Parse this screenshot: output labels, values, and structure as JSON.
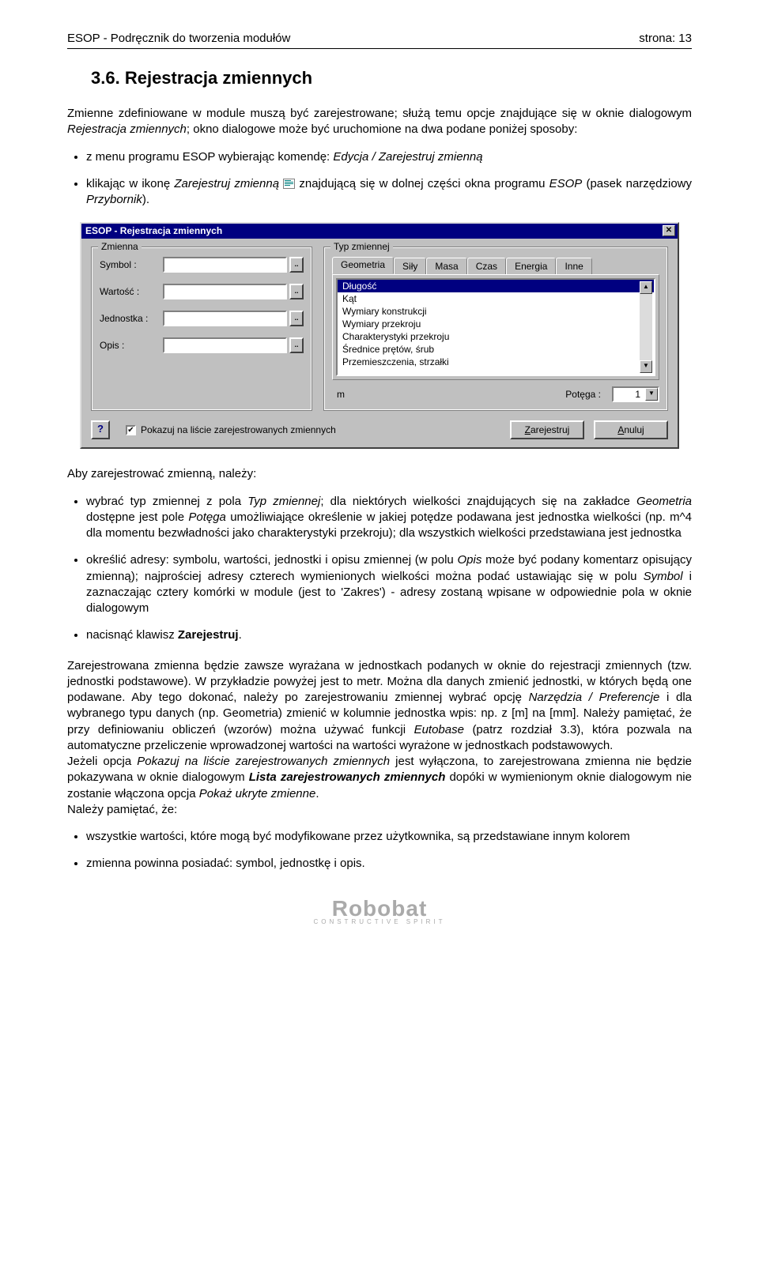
{
  "header": {
    "left": "ESOP - Podręcznik do tworzenia modułów",
    "right": "strona: 13"
  },
  "section": {
    "number": "3.6.",
    "title": "Rejestracja zmiennych"
  },
  "intro": {
    "p1_a": "Zmienne zdefiniowane w module muszą być zarejestrowane; służą temu opcje znajdujące się w oknie dialogowym ",
    "p1_i": "Rejestracja zmiennych",
    "p1_b": "; okno dialogowe może być uruchomione na dwa podane poniżej sposoby:"
  },
  "intro_bullets": {
    "b1_a": "z menu programu ESOP wybierając komendę: ",
    "b1_i": "Edycja / Zarejestruj zmienną",
    "b2_a": "klikając w ikonę ",
    "b2_i": "Zarejestruj zmienną",
    "b2_b": " znajdującą się w dolnej części okna programu ",
    "b2_i2": "ESOP",
    "b2_c": " (pasek narzędziowy ",
    "b2_i3": "Przybornik",
    "b2_d": ")."
  },
  "dialog": {
    "title": "ESOP - Rejestracja zmiennych",
    "left": {
      "legend": "Zmienna",
      "fields": {
        "symbol": "Symbol :",
        "value": "Wartość :",
        "unit": "Jednostka :",
        "desc": "Opis :"
      }
    },
    "right": {
      "legend": "Typ zmiennej",
      "tabs": [
        "Geometria",
        "Siły",
        "Masa",
        "Czas",
        "Energia",
        "Inne"
      ],
      "items": [
        "Długość",
        "Kąt",
        "Wymiary konstrukcji",
        "Wymiary przekroju",
        "Charakterystyki przekroju",
        "Średnice prętów, śrub",
        "Przemieszczenia, strzałki"
      ],
      "unit": "m",
      "potega_label": "Potęga :",
      "potega_value": "1"
    },
    "bottom": {
      "checkbox": "Pokazuj na liście zarejestrowanych zmiennych",
      "register": "Zarejestruj",
      "cancel": "Anuluj"
    }
  },
  "after": {
    "lead": "Aby zarejestrować zmienną, należy:"
  },
  "after_bullets": {
    "b1_a": "wybrać typ zmiennej z pola ",
    "b1_i1": "Typ zmiennej",
    "b1_b": "; dla niektórych wielkości znajdujących się na zakładce ",
    "b1_i2": "Geometria",
    "b1_c": " dostępne jest pole ",
    "b1_i3": "Potęga",
    "b1_d": " umożliwiające określenie w jakiej potędze podawana jest jednostka wielkości (np. m^4 dla momentu bezwładności jako charakterystyki przekroju); dla wszystkich wielkości przedstawiana jest jednostka",
    "b2_a": "określić adresy: symbolu, wartości, jednostki i opisu zmiennej (w polu ",
    "b2_i1": "Opis",
    "b2_b": " może być podany komentarz opisujący zmienną); najprościej adresy czterech wymienionych wielkości można podać ustawiając się w polu ",
    "b2_i2": "Symbol",
    "b2_c": " i zaznaczając cztery komórki w module (jest to 'Zakres') - adresy zostaną wpisane w odpowiednie pola w oknie dialogowym",
    "b3_a": "nacisnąć klawisz ",
    "b3_bold": "Zarejestruj",
    "b3_b": "."
  },
  "para2": {
    "a": "Zarejestrowana zmienna będzie zawsze wyrażana w jednostkach podanych w oknie do rejestracji zmiennych (tzw. jednostki podstawowe). W przykładzie powyżej jest to metr. Można dla danych zmienić jednostki, w których będą one podawane. Aby tego dokonać, należy po zarejestrowaniu zmiennej wybrać opcję ",
    "i1": "Narzędzia / Preferencje",
    "b": " i dla wybranego typu danych (np. Geometria) zmienić w kolumnie jednostka wpis: np. z [m] na [mm]. Należy pamiętać, że przy definiowaniu obliczeń (wzorów) można używać funkcji ",
    "i2": "Eutobase",
    "c": " (patrz rozdział 3.3), która pozwala na automatyczne przeliczenie wprowadzonej wartości na wartości wyrażone w jednostkach podstawowych."
  },
  "para3": {
    "a": "Jeżeli opcja ",
    "i1": "Pokazuj na liście zarejestrowanych zmiennych",
    "b": " jest wyłączona, to zarejestrowana zmienna nie będzie pokazywana w oknie dialogowym ",
    "i2_bold": "Lista zarejestrowanych zmiennych",
    "c": " dopóki w wymienionym oknie dialogowym nie zostanie włączona opcja ",
    "i3": "Pokaż ukryte zmienne",
    "d": "."
  },
  "para4": "Należy pamiętać, że:",
  "final_bullets": {
    "b1": "wszystkie wartości, które mogą być modyfikowane przez użytkownika, są przedstawiane innym kolorem",
    "b2": "zmienna powinna posiadać: symbol, jednostkę i opis."
  },
  "logo": {
    "main": "Robobat",
    "sub": "CONSTRUCTIVE SPIRIT"
  }
}
